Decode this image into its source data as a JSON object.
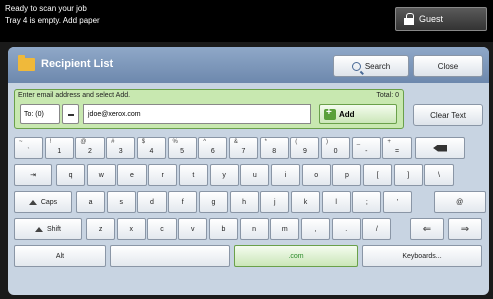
{
  "status": {
    "line1": "Ready to scan your job",
    "line2": "Tray 4 is empty. Add paper",
    "guest_label": "Guest"
  },
  "recipient_list": {
    "title": "Recipient List",
    "search_label": "Search",
    "close_label": "Close",
    "prompt": "Enter email address and select Add.",
    "total": "Total: 0",
    "to_value": "To: (0)",
    "email_value": "jdoe@xerox.com",
    "add_label": "Add",
    "clear_label": "Clear Text"
  },
  "keyboard": {
    "row1": [
      {
        "upper": "~",
        "lower": "`"
      },
      {
        "upper": "!",
        "lower": "1"
      },
      {
        "upper": "@",
        "lower": "2"
      },
      {
        "upper": "#",
        "lower": "3"
      },
      {
        "upper": "$",
        "lower": "4"
      },
      {
        "upper": "%",
        "lower": "5"
      },
      {
        "upper": "^",
        "lower": "6"
      },
      {
        "upper": "&",
        "lower": "7"
      },
      {
        "upper": "*",
        "lower": "8"
      },
      {
        "upper": "(",
        "lower": "9"
      },
      {
        "upper": ")",
        "lower": "0"
      },
      {
        "upper": "_",
        "lower": "-"
      },
      {
        "upper": "+",
        "lower": "="
      }
    ],
    "row2": [
      "q",
      "w",
      "e",
      "r",
      "t",
      "y",
      "u",
      "i",
      "o",
      "p",
      "[",
      "]",
      "\\"
    ],
    "row3": [
      "a",
      "s",
      "d",
      "f",
      "g",
      "h",
      "j",
      "k",
      "l",
      ";",
      "'"
    ],
    "row4": [
      "z",
      "x",
      "c",
      "v",
      "b",
      "n",
      "m",
      ",",
      ".",
      "/"
    ],
    "caps_label": "Caps",
    "shift_label": "Shift",
    "alt_label": "Alt",
    "com_label": ".com",
    "keyboards_label": "Keyboards...",
    "at_label": "@"
  }
}
